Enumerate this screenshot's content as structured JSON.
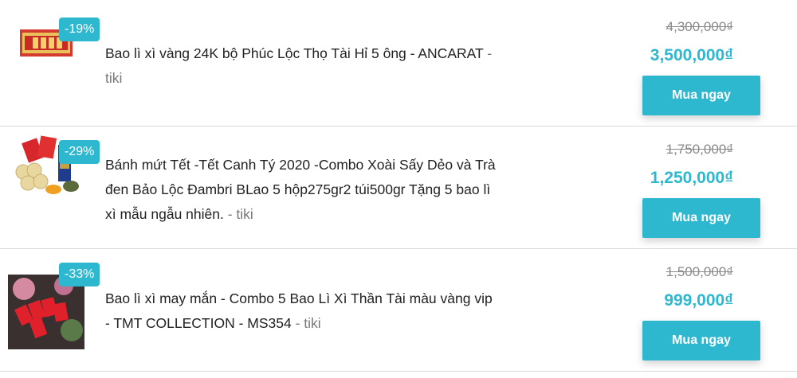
{
  "products": [
    {
      "discount": "-19%",
      "title": "Bao lì xì vàng 24K bộ Phúc Lộc Thọ Tài Hỉ 5 ông - ANCARAT",
      "source": "tiki",
      "old_price": "4,300,000₫",
      "new_price": "3,500,000₫",
      "button": "Mua ngay"
    },
    {
      "discount": "-29%",
      "title": "Bánh mứt Tết -Tết Canh Tý 2020 -Combo Xoài Sấy Dẻo và Trà đen Bảo Lộc Đambri BLao 5 hộp275gr2 túi500gr Tặng 5 bao lì xì mẫu ngẫu nhiên.",
      "source": "tiki",
      "old_price": "1,750,000₫",
      "new_price": "1,250,000₫",
      "button": "Mua ngay"
    },
    {
      "discount": "-33%",
      "title": "Bao lì xì may mắn - Combo 5 Bao Lì Xì Thần Tài màu vàng vip - TMT COLLECTION - MS354",
      "source": "tiki",
      "old_price": "1,500,000₫",
      "new_price": "999,000₫",
      "button": "Mua ngay"
    }
  ],
  "colors": {
    "accent": "#2eb8d0",
    "old_price": "#8a8a8a"
  }
}
